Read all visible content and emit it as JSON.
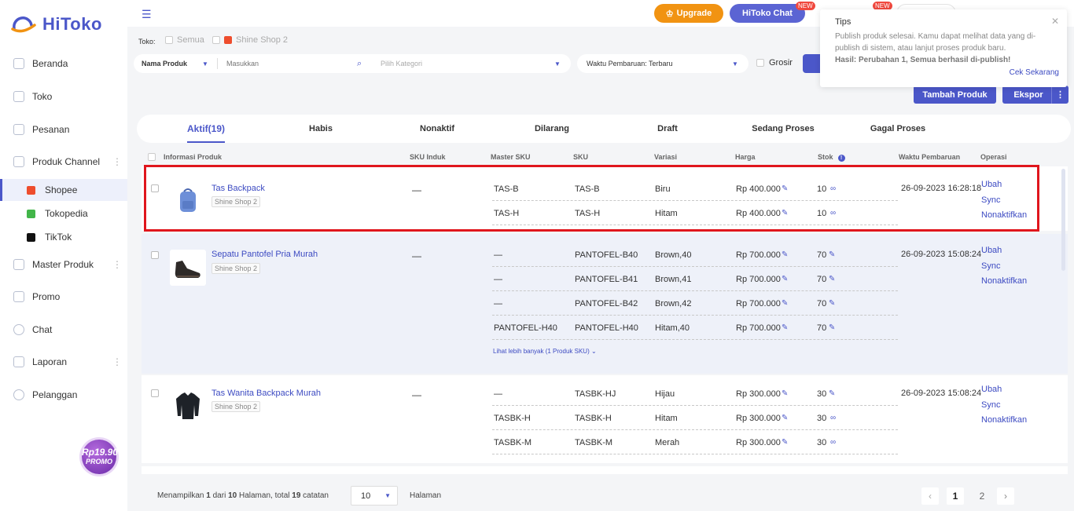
{
  "app": {
    "logo_text": "HiToko"
  },
  "sidebar": {
    "items": [
      {
        "label": "Beranda"
      },
      {
        "label": "Toko"
      },
      {
        "label": "Pesanan"
      },
      {
        "label": "Produk Channel"
      },
      {
        "label": "Master Produk"
      },
      {
        "label": "Promo"
      },
      {
        "label": "Chat"
      },
      {
        "label": "Laporan"
      },
      {
        "label": "Pelanggan"
      }
    ],
    "sub_items": [
      {
        "label": "Shopee",
        "color": "#ee4d2d"
      },
      {
        "label": "Tokopedia",
        "color": "#42b549"
      },
      {
        "label": "TikTok",
        "color": "#111111"
      }
    ],
    "promo": {
      "price": "Rp19.900",
      "label": "PROMO"
    }
  },
  "topbar": {
    "upgrade_label": "Upgrade",
    "chat_label": "HiToko Chat",
    "new_badge": "NEW"
  },
  "filters": {
    "toko_label": "Toko:",
    "toko_options": [
      "Semua",
      "Shine Shop 2"
    ],
    "search_type": "Nama Produk",
    "search_placeholder": "Masukkan",
    "category_placeholder": "Pilih Kategori",
    "sort_value": "Waktu Pembaruan: Terbaru",
    "grosir_label": "Grosir",
    "tambah_label": "Tambah Produk",
    "ekspor_label": "Ekspor"
  },
  "tips": {
    "title": "Tips",
    "body": "Publish produk selesai. Kamu dapat melihat data yang di-publish di sistem, atau lanjut proses produk baru.",
    "result": "Hasil: Perubahan 1, Semua berhasil di-publish!",
    "link": "Cek Sekarang"
  },
  "tabs": [
    {
      "label": "Aktif",
      "count": "(19)"
    },
    {
      "label": "Habis"
    },
    {
      "label": "Nonaktif"
    },
    {
      "label": "Dilarang"
    },
    {
      "label": "Draft"
    },
    {
      "label": "Sedang Proses"
    },
    {
      "label": "Gagal Proses"
    }
  ],
  "table": {
    "headers": [
      "Informasi Produk",
      "SKU Induk",
      "Master SKU",
      "SKU",
      "Variasi",
      "Harga",
      "Stok",
      "Waktu Pembaruan",
      "Operasi"
    ],
    "operations": [
      "Ubah",
      "Sync",
      "Nonaktifkan"
    ],
    "products": [
      {
        "name": "Tas Backpack",
        "shop": "Shine Shop 2",
        "sku_induk": "—",
        "updated": "26-09-2023 16:28:18",
        "variants": [
          {
            "master_sku": "TAS-B",
            "sku": "TAS-B",
            "variasi": "Biru",
            "harga": "Rp 400.000",
            "stok": "10"
          },
          {
            "master_sku": "TAS-H",
            "sku": "TAS-H",
            "variasi": "Hitam",
            "harga": "Rp 400.000",
            "stok": "10"
          }
        ]
      },
      {
        "name": "Sepatu Pantofel Pria Murah",
        "shop": "Shine Shop 2",
        "sku_induk": "—",
        "updated": "26-09-2023 15:08:24",
        "see_more": "Lihat lebih banyak (1 Produk SKU)",
        "variants": [
          {
            "master_sku": "—",
            "sku": "PANTOFEL-B40",
            "variasi": "Brown,40",
            "harga": "Rp 700.000",
            "stok": "70"
          },
          {
            "master_sku": "—",
            "sku": "PANTOFEL-B41",
            "variasi": "Brown,41",
            "harga": "Rp 700.000",
            "stok": "70"
          },
          {
            "master_sku": "—",
            "sku": "PANTOFEL-B42",
            "variasi": "Brown,42",
            "harga": "Rp 700.000",
            "stok": "70"
          },
          {
            "master_sku": "PANTOFEL-H40",
            "sku": "PANTOFEL-H40",
            "variasi": "Hitam,40",
            "harga": "Rp 700.000",
            "stok": "70"
          }
        ]
      },
      {
        "name": "Tas Wanita Backpack Murah",
        "shop": "Shine Shop 2",
        "sku_induk": "—",
        "updated": "26-09-2023 15:08:24",
        "variants": [
          {
            "master_sku": "—",
            "sku": "TASBK-HJ",
            "variasi": "Hijau",
            "harga": "Rp 300.000",
            "stok": "30"
          },
          {
            "master_sku": "TASBK-H",
            "sku": "TASBK-H",
            "variasi": "Hitam",
            "harga": "Rp 300.000",
            "stok": "30"
          },
          {
            "master_sku": "TASBK-M",
            "sku": "TASBK-M",
            "variasi": "Merah",
            "harga": "Rp 300.000",
            "stok": "30"
          }
        ]
      }
    ]
  },
  "pagination": {
    "summary_prefix": "Menampilkan",
    "current": "1",
    "dari": "dari",
    "total_pages": "10",
    "halaman_word": "Halaman",
    "total_word": ", total",
    "total": "19",
    "catatan": "catatan",
    "page_size": "10",
    "halaman_label": "Halaman",
    "pages": [
      "1",
      "2"
    ]
  },
  "colors": {
    "accent": "#4b57c9",
    "upgrade": "#f19312",
    "highlight": "#e0161d",
    "badge": "#f0483e"
  }
}
